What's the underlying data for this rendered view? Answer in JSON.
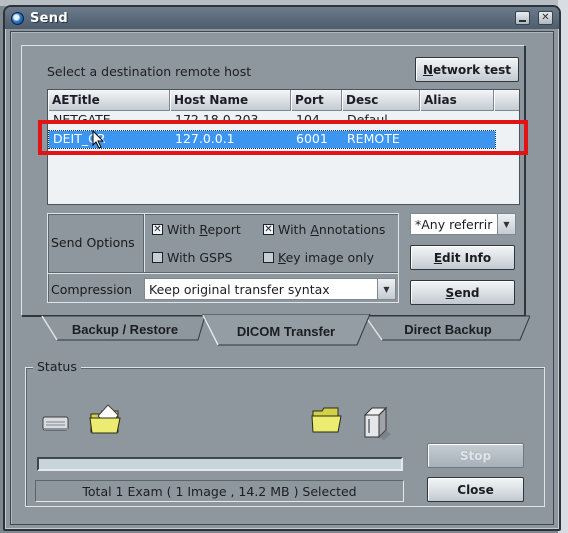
{
  "window": {
    "title": "Send",
    "minimize_label": "",
    "close_glyph": "✕"
  },
  "destination": {
    "prompt": "Select a destination remote host",
    "network_test_label": "Network test",
    "network_test_mnemonic": "N",
    "columns": [
      "AETitle",
      "Host Name",
      "Port",
      "Desc",
      "Alias"
    ],
    "rows": [
      {
        "aetitle": "NETGATE",
        "host": "172.18.0.203",
        "port": "104",
        "desc": "Defaul...",
        "alias": "",
        "selected": false
      },
      {
        "aetitle": "DEIT_CR",
        "host": "127.0.0.1",
        "port": "6001",
        "desc": "REMOTE",
        "alias": "",
        "selected": true
      }
    ]
  },
  "send_options": {
    "label": "Send Options",
    "options": [
      {
        "label": "With Report",
        "mnemonic": "R",
        "checked": true
      },
      {
        "label": "With Annotations",
        "mnemonic": "A",
        "checked": true
      },
      {
        "label": "With GSPS",
        "mnemonic": "",
        "checked": false
      },
      {
        "label": "Key image only",
        "mnemonic": "K",
        "checked": false
      }
    ],
    "compression_label": "Compression",
    "compression_value": "Keep original transfer syntax",
    "referring_value": "*Any referrir"
  },
  "actions": {
    "edit_info": "Edit Info",
    "send": "Send",
    "stop": "Stop",
    "close": "Close"
  },
  "tabs": [
    {
      "label": "Backup / Restore",
      "active": false
    },
    {
      "label": "DICOM Transfer",
      "active": true
    },
    {
      "label": "Direct Backup",
      "active": false
    }
  ],
  "status": {
    "legend": "Status",
    "progress_percent": 0,
    "summary": "Total 1 Exam ( 1 Image , 14.2 MB ) Selected",
    "icons": [
      "local-drive-icon",
      "open-folder-icon",
      "folder-icon",
      "server-icon"
    ]
  },
  "colors": {
    "selection": "#3c96f0",
    "highlight_box": "#e01414",
    "window_bg": "#8f979e",
    "titlebar": "#5a6a7a"
  }
}
